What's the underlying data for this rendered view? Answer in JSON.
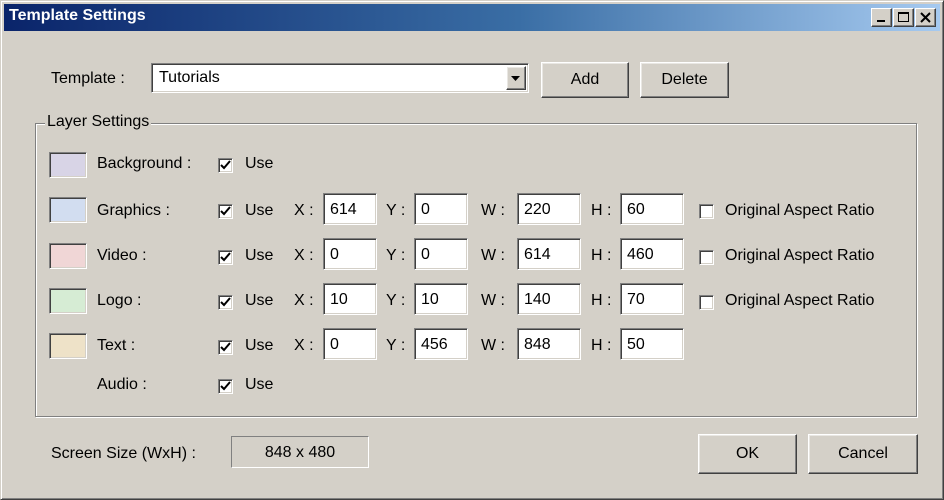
{
  "window": {
    "title": "Template Settings"
  },
  "template": {
    "label": "Template :",
    "selected": "Tutorials",
    "add_label": "Add",
    "delete_label": "Delete"
  },
  "layer_settings": {
    "group_title": "Layer Settings",
    "x_label": "X :",
    "y_label": "Y :",
    "w_label": "W :",
    "h_label": "H :",
    "use_label": "Use",
    "aspect_label": "Original Aspect Ratio",
    "layers": [
      {
        "name": "Background :",
        "swatch_color": "#d8d4e6",
        "use": true
      },
      {
        "name": "Graphics :",
        "swatch_color": "#d2ddf0",
        "use": true,
        "x": "614",
        "y": "0",
        "w": "220",
        "h": "60",
        "aspect": false
      },
      {
        "name": "Video :",
        "swatch_color": "#f0d6d6",
        "use": true,
        "x": "0",
        "y": "0",
        "w": "614",
        "h": "460",
        "aspect": false
      },
      {
        "name": "Logo :",
        "swatch_color": "#d6ecd4",
        "use": true,
        "x": "10",
        "y": "10",
        "w": "140",
        "h": "70",
        "aspect": false
      },
      {
        "name": "Text :",
        "swatch_color": "#eee2c8",
        "use": true,
        "x": "0",
        "y": "456",
        "w": "848",
        "h": "50"
      },
      {
        "name": "Audio :",
        "use": true
      }
    ]
  },
  "screen_size": {
    "label": "Screen Size (WxH) :",
    "value": "848 x 480"
  },
  "footer": {
    "ok_label": "OK",
    "cancel_label": "Cancel"
  },
  "colors": {
    "titlebar_start": "#0a246a",
    "titlebar_end": "#a6caf0",
    "dialog_bg": "#d4d0c8"
  }
}
